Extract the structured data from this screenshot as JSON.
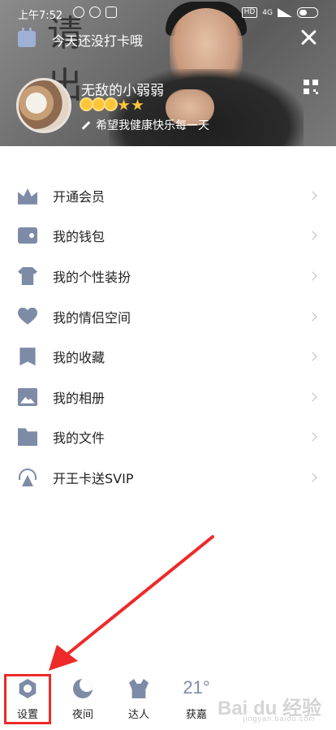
{
  "status_bar": {
    "time": "上午7:52",
    "hd": "HD",
    "network": "4G"
  },
  "header": {
    "checkin_text": "今天还没打卡哦",
    "calligraphy": "请\n出",
    "username": "无敌的小弱弱",
    "signature": "希望我健康快乐每一天",
    "level": {
      "suns": 3,
      "stars": 2
    }
  },
  "menu": {
    "items": [
      {
        "label": "开通会员",
        "icon": "crown-icon"
      },
      {
        "label": "我的钱包",
        "icon": "wallet-icon"
      },
      {
        "label": "我的个性装扮",
        "icon": "shirt-icon"
      },
      {
        "label": "我的情侣空间",
        "icon": "heart-icon"
      },
      {
        "label": "我的收藏",
        "icon": "bookmark-icon"
      },
      {
        "label": "我的相册",
        "icon": "album-icon"
      },
      {
        "label": "我的文件",
        "icon": "folder-icon"
      },
      {
        "label": "开王卡送SVIP",
        "icon": "signal-tower-icon"
      }
    ]
  },
  "bottom_bar": {
    "settings_label": "设置",
    "night_label": "夜间",
    "expert_label": "达人",
    "weather_temp": "21°",
    "weather_location": "获嘉"
  },
  "watermark": {
    "brand": "Bai du 经验",
    "url": "jingyan.baidu.com"
  },
  "colors": {
    "icon": "#7d8ba7",
    "annotation": "#ee2a2a"
  }
}
